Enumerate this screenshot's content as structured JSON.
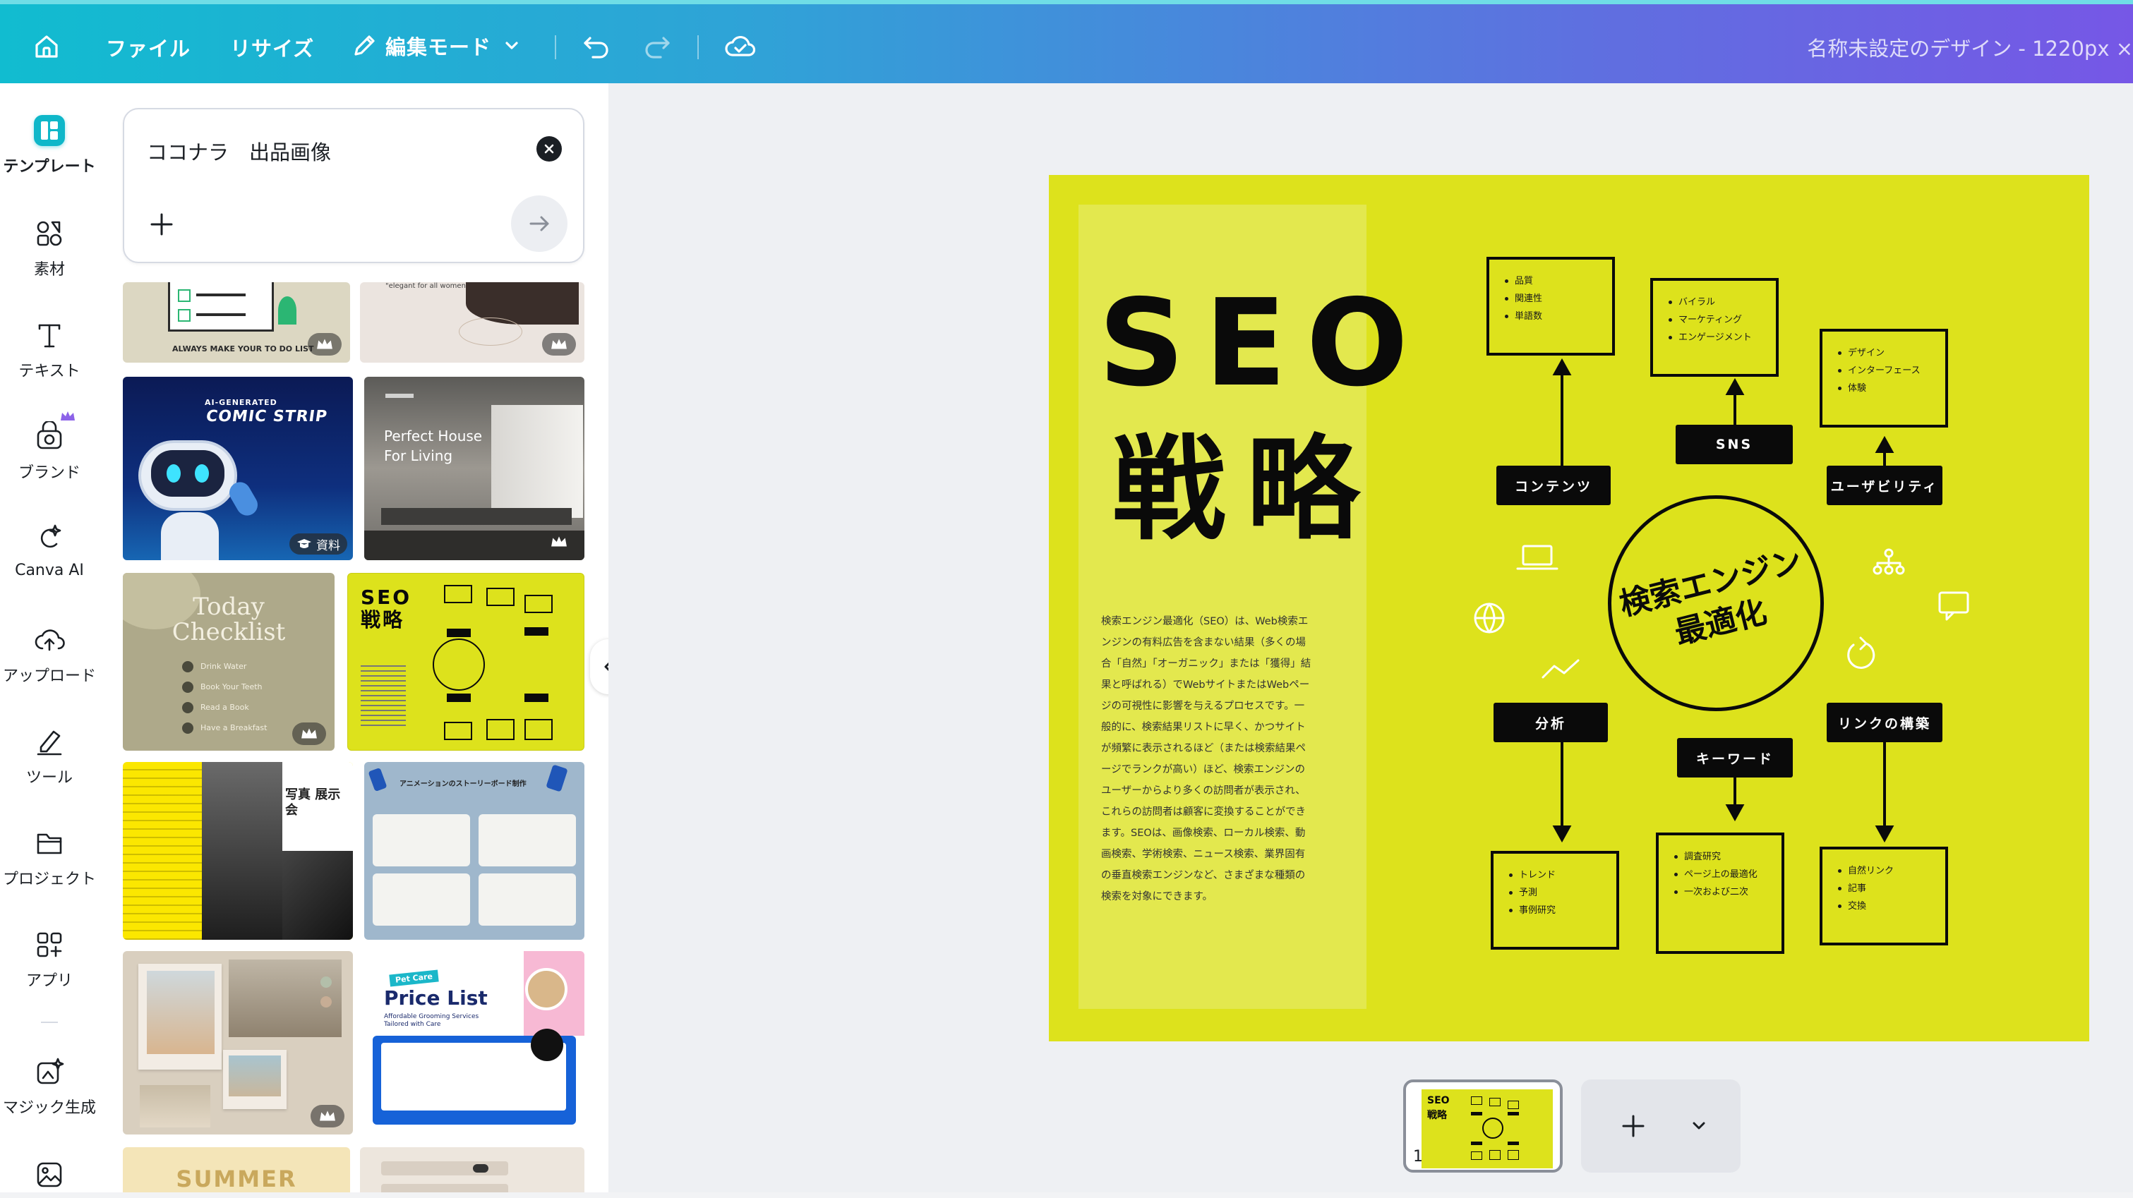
{
  "toolbar": {
    "file_label": "ファイル",
    "resize_label": "リサイズ",
    "edit_mode_label": "編集モード",
    "document_title": "名称未設定のデザイン - 1220px ×"
  },
  "rail": {
    "items": [
      {
        "label": "テンプレート",
        "icon": "template-icon",
        "active": true
      },
      {
        "label": "素材",
        "icon": "elements-icon"
      },
      {
        "label": "テキスト",
        "icon": "text-icon"
      },
      {
        "label": "ブランド",
        "icon": "brand-icon"
      },
      {
        "label": "Canva AI",
        "icon": "canva-ai-icon"
      },
      {
        "label": "アップロード",
        "icon": "upload-icon"
      },
      {
        "label": "ツール",
        "icon": "tools-icon"
      },
      {
        "label": "プロジェクト",
        "icon": "folder-icon"
      },
      {
        "label": "アプリ",
        "icon": "apps-icon"
      },
      {
        "label": "マジック生成",
        "icon": "magic-icon"
      }
    ]
  },
  "panel": {
    "search_value": "ココナラ　出品画像",
    "thumbs": {
      "todo": "ALWAYS MAKE YOUR TO DO LIST",
      "elegant": "\"elegant for all women\"",
      "comic_title": "COMIC STRIP",
      "comic_sub": "AI-GENERATED",
      "comic_badge": "資料",
      "house_title": "Perfect House For Living",
      "checklist_title": "Today Checklist",
      "checklist_items": [
        "Drink Water",
        "Book Your Teeth",
        "Read a Book",
        "Have a Breakfast"
      ],
      "seo_title": "SEO 戦略",
      "photo_exhibit": "写真 展示会",
      "storyboard_title": "アニメーションのストーリーボード制作",
      "price_tag": "Pet Care",
      "price_title": "Price List",
      "price_sub": "Affordable Grooming Services Tailored with Care",
      "summer": "SUMMER"
    }
  },
  "design": {
    "title_seo": "SEO",
    "title_senryaku": "戦略",
    "body": "検索エンジン最適化（SEO）は、Web検索エンジンの有料広告を含まない結果（多くの場合「自然」「オーガニック」または「獲得」結果と呼ばれる）でWebサイトまたはWebページの可視性に影響を与えるプロセスです。一般的に、検索結果リストに早く、かつサイトが頻繁に表示されるほど（または検索結果ページでランクが高い）ほど、検索エンジンのユーザーからより多くの訪問者が表示され、これらの訪問者は顧客に変換することができます。SEOは、画像検索、ローカル検索、動画検索、学術検索、ニュース検索、業界固有の垂直検索エンジンなど、さまざまな種類の検索を対象にできます。",
    "center": [
      "検索エンジン",
      "最適化"
    ],
    "nodes": {
      "content": "コンテンツ",
      "sns": "SNS",
      "usability": "ユーザビリティ",
      "analysis": "分析",
      "keyword": "キーワード",
      "link": "リンクの構築"
    },
    "boxes": {
      "content": [
        "品質",
        "関連性",
        "単語数"
      ],
      "sns": [
        "バイラル",
        "マーケティング",
        "エンゲージメント"
      ],
      "usability": [
        "デザイン",
        "インターフェース",
        "体験"
      ],
      "analysis": [
        "トレンド",
        "予測",
        "事例研究"
      ],
      "keyword": [
        "調査研究",
        "ページ上の最適化",
        "一次および二次"
      ],
      "link": [
        "自然リンク",
        "記事",
        "交換"
      ]
    }
  },
  "pages": {
    "current_page": "1"
  },
  "colors": {
    "accent_yellow": "#dde21c",
    "topbar_start": "#11bcd0",
    "topbar_end": "#7657e6"
  }
}
